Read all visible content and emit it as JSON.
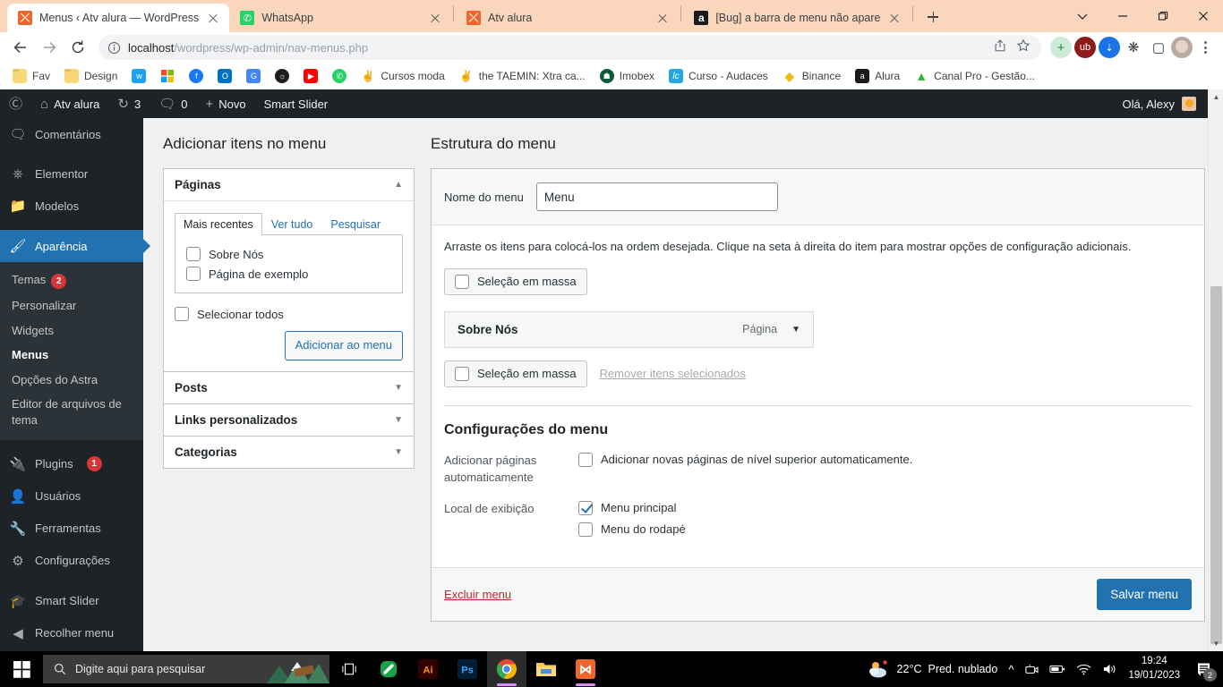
{
  "browser": {
    "tabs": [
      {
        "title": "Menus ‹ Atv alura — WordPress",
        "favicon": "xampp-icon",
        "active": true
      },
      {
        "title": "WhatsApp",
        "favicon": "whatsapp-icon",
        "active": false
      },
      {
        "title": "Atv alura",
        "favicon": "xampp-icon",
        "active": false
      },
      {
        "title": "[Bug] a barra de menu não apare",
        "favicon": "alura-icon",
        "active": false
      }
    ],
    "new_tab_label": "+",
    "url_bold": "localhost",
    "url_rest": "/wordpress/wp-admin/nav-menus.php",
    "bookmarks": [
      {
        "label": "Fav",
        "icon": "folder-icon"
      },
      {
        "label": "Design",
        "icon": "folder-icon"
      },
      {
        "label": "",
        "icon": "twitter-icon"
      },
      {
        "label": "",
        "icon": "microsoft-icon"
      },
      {
        "label": "",
        "icon": "facebook-icon"
      },
      {
        "label": "",
        "icon": "outlook-icon"
      },
      {
        "label": "",
        "icon": "google-translate-icon"
      },
      {
        "label": "",
        "icon": "globe-icon"
      },
      {
        "label": "",
        "icon": "youtube-icon"
      },
      {
        "label": "",
        "icon": "whatsapp-icon"
      },
      {
        "label": "Cursos moda",
        "icon": "hand-icon"
      },
      {
        "label": "the TAEMIN: Xtra ca...",
        "icon": "peace-icon"
      },
      {
        "label": "Imobex",
        "icon": "imobex-icon"
      },
      {
        "label": "Curso - Audaces",
        "icon": "audaces-icon"
      },
      {
        "label": "Binance",
        "icon": "binance-icon"
      },
      {
        "label": "Alura",
        "icon": "alura-icon"
      },
      {
        "label": "Canal Pro - Gestão...",
        "icon": "canalpro-icon"
      }
    ]
  },
  "adminbar": {
    "site_name": "Atv alura",
    "updates_count": "3",
    "comments_count": "0",
    "new_label": "Novo",
    "smart_slider_label": "Smart Slider",
    "greeting": "Olá, Alexy"
  },
  "sidebar": {
    "items": [
      {
        "label": "Comentários",
        "icon": "comment-icon",
        "current": false
      },
      {
        "label": "Elementor",
        "icon": "elementor-icon",
        "current": false
      },
      {
        "label": "Modelos",
        "icon": "folder-icon",
        "current": false
      },
      {
        "label": "Aparência",
        "icon": "appearance-brush-icon",
        "current": true
      }
    ],
    "submenu": [
      {
        "label": "Temas",
        "badge": "2",
        "current": false
      },
      {
        "label": "Personalizar",
        "badge": "",
        "current": false
      },
      {
        "label": "Widgets",
        "badge": "",
        "current": false
      },
      {
        "label": "Menus",
        "badge": "",
        "current": true
      },
      {
        "label": "Opções do Astra",
        "badge": "",
        "current": false
      },
      {
        "label": "Editor de arquivos de tema",
        "badge": "",
        "current": false
      }
    ],
    "items_after": [
      {
        "label": "Plugins",
        "icon": "plug-icon",
        "badge": "1"
      },
      {
        "label": "Usuários",
        "icon": "user-icon",
        "badge": ""
      },
      {
        "label": "Ferramentas",
        "icon": "wrench-icon",
        "badge": ""
      },
      {
        "label": "Configurações",
        "icon": "sliders-icon",
        "badge": ""
      }
    ],
    "items_last": [
      {
        "label": "Smart Slider",
        "icon": "slider-icon"
      },
      {
        "label": "Recolher menu",
        "icon": "collapse-arrow-icon"
      }
    ]
  },
  "add_items": {
    "title": "Adicionar itens no menu",
    "pages_box": {
      "heading": "Páginas",
      "tabs": [
        {
          "label": "Mais recentes",
          "active": true
        },
        {
          "label": "Ver tudo",
          "active": false
        },
        {
          "label": "Pesquisar",
          "active": false
        }
      ],
      "page_items": [
        {
          "label": "Sobre Nós",
          "checked": false
        },
        {
          "label": "Página de exemplo",
          "checked": false
        }
      ],
      "select_all_label": "Selecionar todos",
      "select_all_checked": false,
      "add_button": "Adicionar ao menu"
    },
    "collapsed_boxes": [
      {
        "heading": "Posts"
      },
      {
        "heading": "Links personalizados"
      },
      {
        "heading": "Categorias"
      }
    ]
  },
  "structure": {
    "title": "Estrutura do menu",
    "name_label": "Nome do menu",
    "name_value": "Menu",
    "help_text": "Arraste os itens para colocá-los na ordem desejada. Clique na seta à direita do item para mostrar opções de configuração adicionais.",
    "bulk_select_label": "Seleção em massa",
    "bulk_select_checked": false,
    "menu_items": [
      {
        "title": "Sobre Nós",
        "type": "Página"
      }
    ],
    "bulk_select_bottom_label": "Seleção em massa",
    "remove_selected_label": "Remover itens selecionados",
    "settings": {
      "title": "Configurações do menu",
      "auto_add_label": "Adicionar páginas automaticamente",
      "auto_add_checkbox_label": "Adicionar novas páginas de nível superior automaticamente.",
      "auto_add_checked": false,
      "display_location_label": "Local de exibição",
      "locations": [
        {
          "label": "Menu principal",
          "checked": true
        },
        {
          "label": "Menu do rodapé",
          "checked": false
        }
      ]
    },
    "delete_link": "Excluir menu",
    "save_button": "Salvar menu"
  },
  "taskbar": {
    "search_placeholder": "Digite aqui para pesquisar",
    "apps": [
      {
        "name": "task-view-icon"
      },
      {
        "name": "onenote-icon"
      },
      {
        "name": "illustrator-icon"
      },
      {
        "name": "photoshop-icon"
      },
      {
        "name": "chrome-icon"
      },
      {
        "name": "file-explorer-icon"
      },
      {
        "name": "xampp-icon"
      }
    ],
    "weather_temp": "22°C",
    "weather_desc": "Pred. nublado",
    "clock_time": "19:24",
    "clock_date": "19/01/2023",
    "notification_count": "2"
  },
  "colors": {
    "wp_admin_dark": "#1d2327",
    "wp_blue": "#2271b1",
    "badge_red": "#d63638",
    "chrome_tabstrip": "#fad6bd"
  }
}
